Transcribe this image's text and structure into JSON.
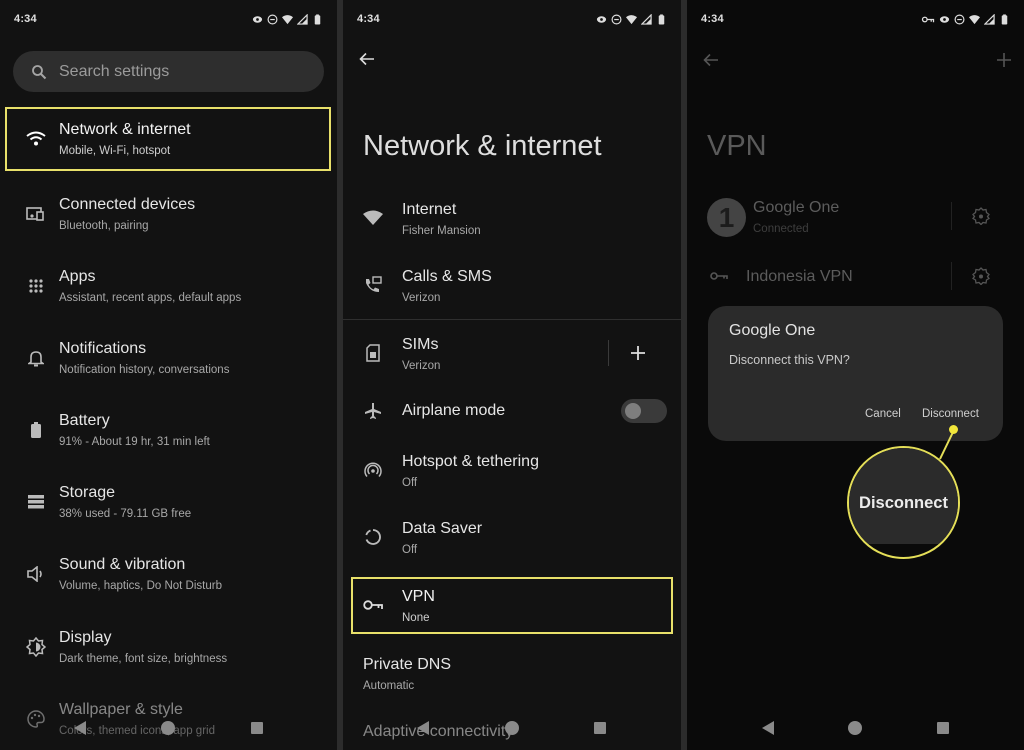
{
  "status_bar": {
    "time": "4:34"
  },
  "colors": {
    "highlight": "#e8e06a",
    "callout": "#e5df58",
    "background": "#121212"
  },
  "panel1": {
    "search_placeholder": "Search settings",
    "items": [
      {
        "title": "Network & internet",
        "subtitle": "Mobile, Wi-Fi, hotspot",
        "icon": "wifi-icon",
        "highlighted": true
      },
      {
        "title": "Connected devices",
        "subtitle": "Bluetooth, pairing",
        "icon": "connected-devices-icon"
      },
      {
        "title": "Apps",
        "subtitle": "Assistant, recent apps, default apps",
        "icon": "apps-grid-icon"
      },
      {
        "title": "Notifications",
        "subtitle": "Notification history, conversations",
        "icon": "bell-icon"
      },
      {
        "title": "Battery",
        "subtitle": "91% - About 19 hr, 31 min left",
        "icon": "battery-icon"
      },
      {
        "title": "Storage",
        "subtitle": "38% used - 79.11 GB free",
        "icon": "storage-icon"
      },
      {
        "title": "Sound & vibration",
        "subtitle": "Volume, haptics, Do Not Disturb",
        "icon": "speaker-icon"
      },
      {
        "title": "Display",
        "subtitle": "Dark theme, font size, brightness",
        "icon": "brightness-icon"
      },
      {
        "title": "Wallpaper & style",
        "subtitle": "Colors, themed icons, app grid",
        "icon": "palette-icon"
      }
    ]
  },
  "panel2": {
    "title": "Network & internet",
    "items": [
      {
        "title": "Internet",
        "subtitle": "Fisher Mansion",
        "icon": "wifi-icon"
      },
      {
        "title": "Calls & SMS",
        "subtitle": "Verizon",
        "icon": "calls-sms-icon"
      },
      {
        "title": "SIMs",
        "subtitle": "Verizon",
        "icon": "sim-icon"
      },
      {
        "title": "Airplane mode",
        "subtitle": "",
        "icon": "airplane-icon",
        "toggle": false
      },
      {
        "title": "Hotspot & tethering",
        "subtitle": "Off",
        "icon": "hotspot-icon"
      },
      {
        "title": "Data Saver",
        "subtitle": "Off",
        "icon": "data-saver-icon"
      },
      {
        "title": "VPN",
        "subtitle": "None",
        "icon": "key-icon",
        "highlighted": true
      },
      {
        "title": "Private DNS",
        "subtitle": "Automatic"
      },
      {
        "title": "Adaptive connectivity",
        "subtitle": ""
      }
    ]
  },
  "panel3": {
    "title": "VPN",
    "vpns": [
      {
        "name": "Google One",
        "status": "Connected",
        "avatar_letter": "1"
      },
      {
        "name": "Indonesia VPN",
        "status": ""
      }
    ],
    "dialog": {
      "title": "Google One",
      "message": "Disconnect this VPN?",
      "cancel_label": "Cancel",
      "confirm_label": "Disconnect"
    },
    "callout_label": "Disconnect"
  }
}
